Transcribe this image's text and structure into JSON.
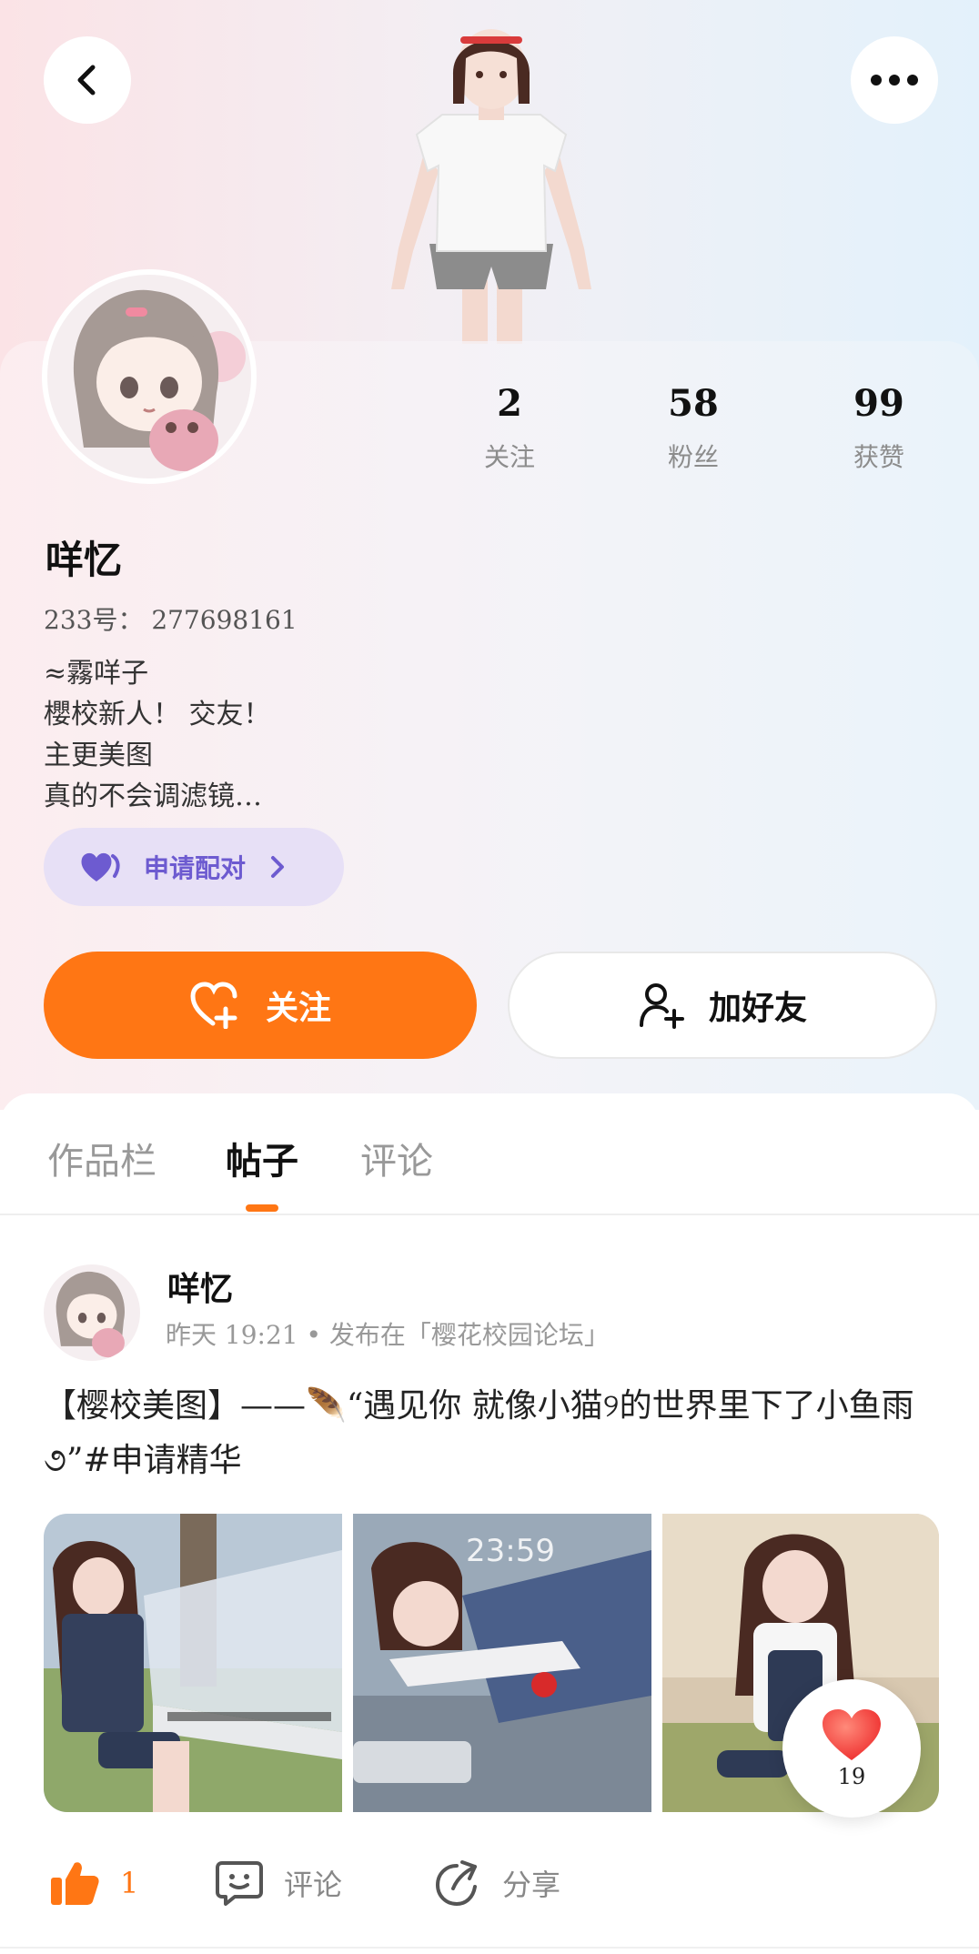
{
  "header": {
    "back_icon": "chevron-left-icon",
    "more_icon": "more-dots-icon"
  },
  "profile": {
    "nickname": "咩忆",
    "uid": "233号： 277698161",
    "bio": [
      "≈霧咩子",
      "櫻校新人！ 交友！",
      "主更美图",
      "真的不会调滤镜…"
    ],
    "stats": [
      {
        "value": "2",
        "label": "关注"
      },
      {
        "value": "58",
        "label": "粉丝"
      },
      {
        "value": "99",
        "label": "获赞"
      }
    ],
    "pair_button": "申请配对",
    "follow_button": "关注",
    "add_friend_button": "加好友"
  },
  "tabs": [
    {
      "label": "作品栏",
      "active": false
    },
    {
      "label": "帖子",
      "active": true
    },
    {
      "label": "评论",
      "active": false
    }
  ],
  "post": {
    "author": "咩忆",
    "meta": "昨天 19:21 • 发布在「樱花校园论坛」",
    "text": "【樱校美图】——🪶“遇见你 就像小猫୨的世界里下了小鱼雨૭”#申请精华",
    "thumb_2_clock": "23:59",
    "float_like_count": "19",
    "like_count": "1",
    "comment_label": "评论",
    "share_label": "分享"
  },
  "colors": {
    "accent": "#ff7614",
    "pair_bg": "#e7e0f6",
    "pair_text": "#6d5bd0"
  }
}
